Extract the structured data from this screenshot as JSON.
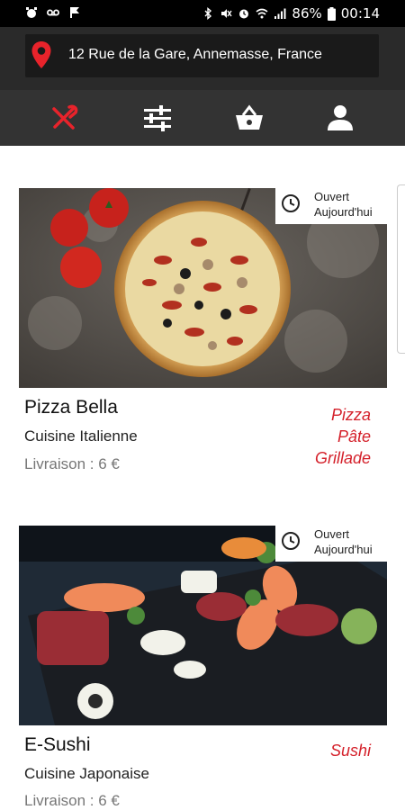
{
  "status_bar": {
    "battery": "86%",
    "time": "00:14"
  },
  "address_bar": {
    "address": "12 Rue de la Gare, Annemasse, France"
  },
  "tabs": [
    {
      "name": "restaurants",
      "icon": "fork-knife-icon",
      "active": true
    },
    {
      "name": "filters",
      "icon": "sliders-icon",
      "active": false
    },
    {
      "name": "basket",
      "icon": "basket-icon",
      "active": false
    },
    {
      "name": "profile",
      "icon": "user-icon",
      "active": false
    }
  ],
  "colors": {
    "accent": "#e8232b",
    "header": "#2a2a2a",
    "tabbar": "#333333"
  },
  "restaurants": [
    {
      "open_line1": "Ouvert",
      "open_line2": "Aujourd'hui",
      "name": "Pizza Bella",
      "cuisine": "Cuisine Italienne",
      "delivery": "Livraison : 6 €",
      "tags": [
        "Pizza",
        "Pâte",
        "Grillade"
      ]
    },
    {
      "open_line1": "Ouvert",
      "open_line2": "Aujourd'hui",
      "name": "E-Sushi",
      "cuisine": "Cuisine Japonaise",
      "delivery": "Livraison : 6 €",
      "tags": [
        "Sushi"
      ]
    }
  ]
}
